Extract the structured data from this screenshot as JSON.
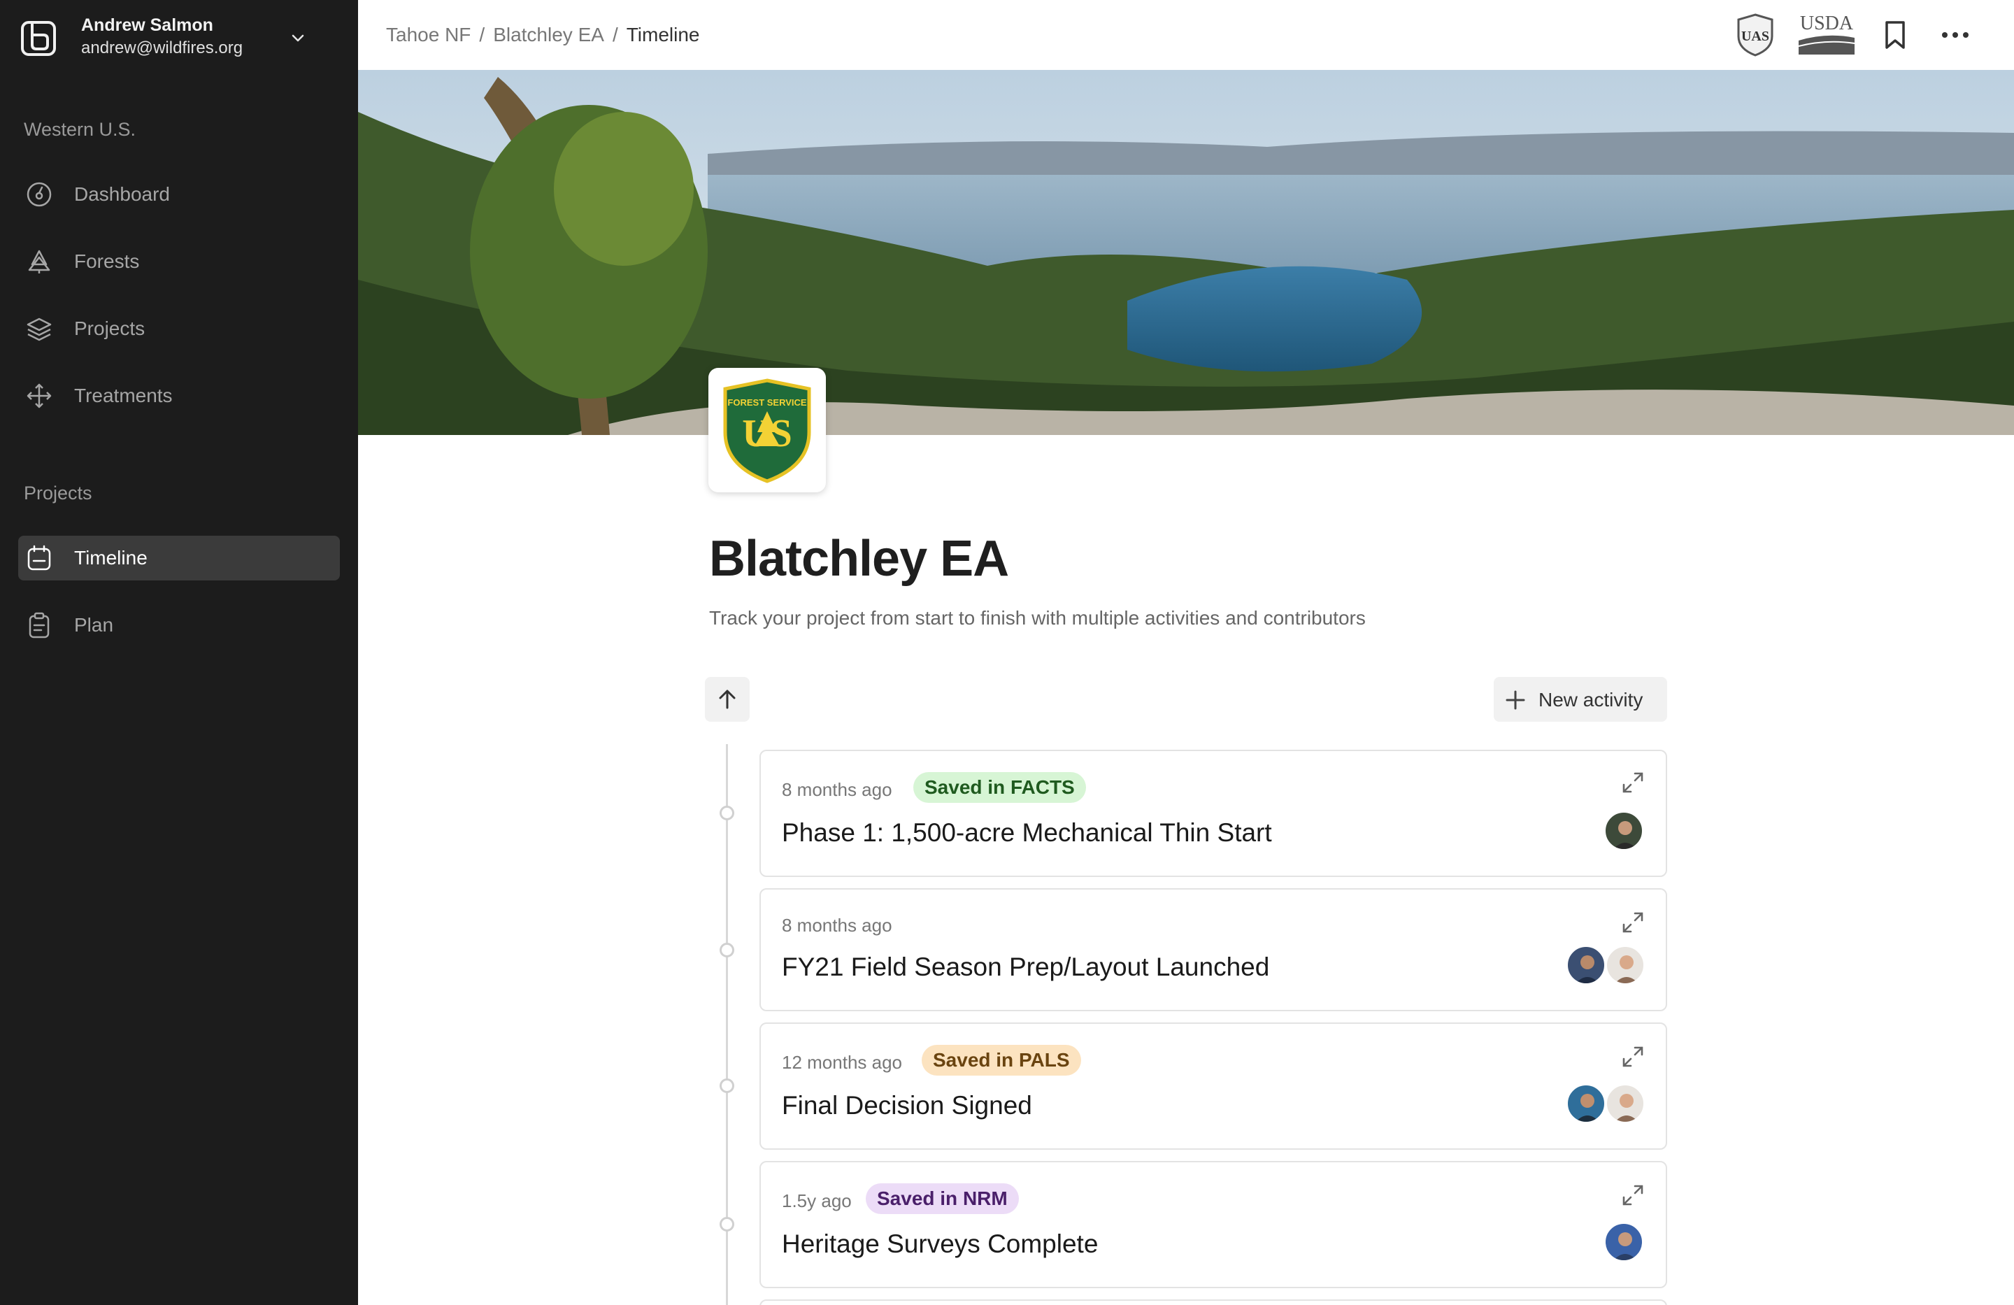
{
  "user": {
    "name": "Andrew Salmon",
    "email": "andrew@wildfires.org"
  },
  "sidebar": {
    "region_label": "Western U.S.",
    "main_items": [
      {
        "label": "Dashboard",
        "icon": "dashboard-icon"
      },
      {
        "label": "Forests",
        "icon": "tree-icon"
      },
      {
        "label": "Projects",
        "icon": "layers-icon"
      },
      {
        "label": "Treatments",
        "icon": "move-icon"
      }
    ],
    "projects_label": "Projects",
    "project_items": [
      {
        "label": "Timeline",
        "icon": "calendar-icon",
        "active": true
      },
      {
        "label": "Plan",
        "icon": "clipboard-icon",
        "active": false
      }
    ]
  },
  "breadcrumb": [
    "Tahoe NF",
    "Blatchley EA",
    "Timeline"
  ],
  "header_logos": [
    "forest-service-shield",
    "USDA"
  ],
  "page": {
    "logo_text": "US",
    "logo_ring_text": "FOREST SERVICE",
    "title": "Blatchley EA",
    "subtitle": "Track your project from start to finish with multiple activities and contributors"
  },
  "toolbar": {
    "new_activity_label": "New activity"
  },
  "activities": [
    {
      "time": "8 months ago",
      "badge": "Saved in FACTS",
      "badge_bg": "#d7f5d5",
      "badge_fg": "#1f5a1f",
      "title": "Phase 1: 1,500-acre Mechanical Thin Start",
      "avatars": 1
    },
    {
      "time": "8 months ago",
      "badge": "",
      "title": "FY21 Field Season Prep/Layout Launched",
      "avatars": 2
    },
    {
      "time": "12 months ago",
      "badge": "Saved in PALS",
      "badge_bg": "#fce3c0",
      "badge_fg": "#6a4410",
      "title": "Final Decision Signed",
      "avatars": 2
    },
    {
      "time": "1.5y ago",
      "badge": "Saved in NRM",
      "badge_bg": "#ecdcf7",
      "badge_fg": "#4a1f6a",
      "title": "Heritage Surveys Complete",
      "avatars": 1
    }
  ]
}
